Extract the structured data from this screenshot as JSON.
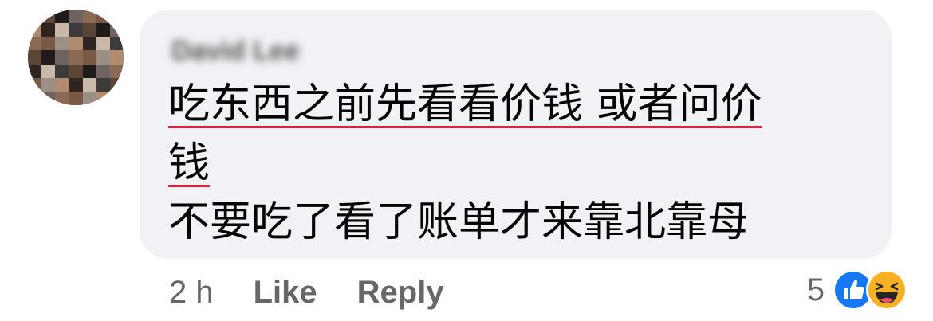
{
  "comment": {
    "author": "David Lee",
    "text_lines": [
      "吃东西之前先看看价钱 或者问价",
      "钱",
      "不要吃了看了账单才来靠北靠母"
    ],
    "timestamp": "2 h",
    "like_label": "Like",
    "reply_label": "Reply",
    "reaction_count": "5",
    "reactions": [
      "like-icon",
      "haha-icon"
    ]
  },
  "colors": {
    "bubble_bg": "#f0f2f5",
    "text": "#050505",
    "meta": "#65676b",
    "spellcheck_underline": "#e41e3f",
    "like_blue": "#1877f2",
    "haha_yellow": "#f7b125"
  }
}
